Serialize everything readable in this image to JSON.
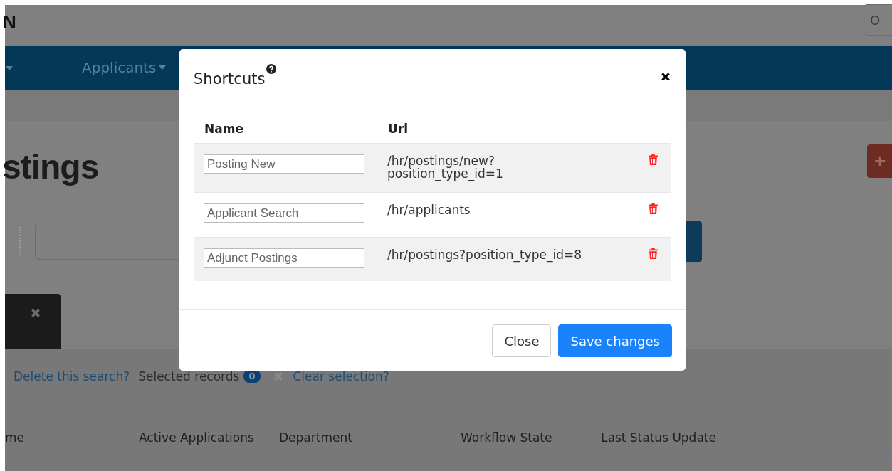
{
  "app_header": {
    "logo": "N",
    "right_button": "O"
  },
  "nav": {
    "items": [
      {
        "label": "Applicants"
      }
    ]
  },
  "page": {
    "title": "stings",
    "add_button": "+"
  },
  "selection_bar": {
    "delete_link": "Delete this search?",
    "selected_label": "Selected records",
    "selected_count": "0",
    "clear_link": "Clear selection?"
  },
  "table": {
    "columns": [
      "me",
      "Active Applications",
      "Department",
      "Workflow State",
      "Last Status Update"
    ]
  },
  "modal": {
    "title": "Shortcuts",
    "columns": [
      "Name",
      "Url"
    ],
    "rows": [
      {
        "name": "Posting New",
        "url": "/hr/postings/new?\nposition_type_id=1"
      },
      {
        "name": "Applicant Search",
        "url": "/hr/applicants"
      },
      {
        "name": "Adjunct Postings",
        "url": "/hr/postings?position_type_id=8"
      }
    ],
    "buttons": [
      {
        "label": "Close",
        "kind": "secondary"
      },
      {
        "label": "Save changes",
        "kind": "primary"
      }
    ]
  }
}
